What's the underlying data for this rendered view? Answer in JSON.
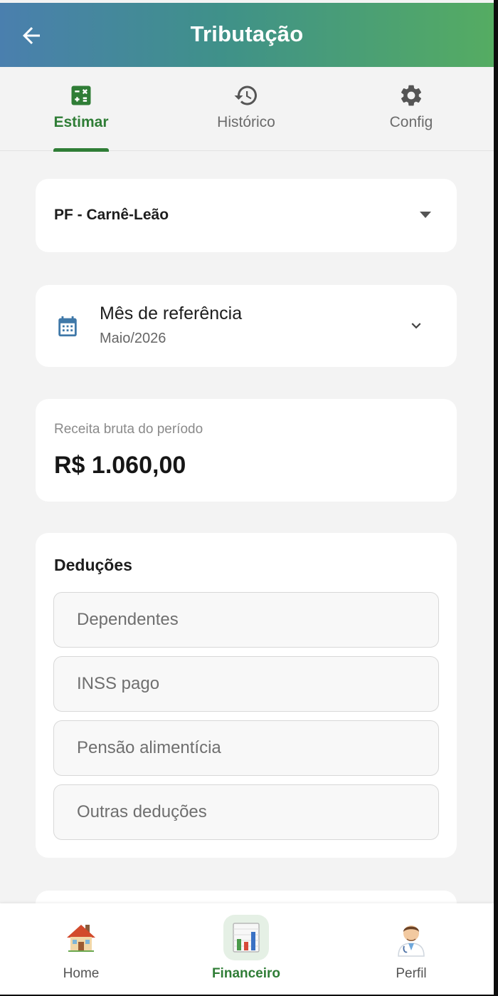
{
  "appbar": {
    "title": "Tributação"
  },
  "tabs": [
    {
      "label": "Estimar",
      "icon": "calculator-icon",
      "active": true
    },
    {
      "label": "Histórico",
      "icon": "history-icon",
      "active": false
    },
    {
      "label": "Config",
      "icon": "gear-icon",
      "active": false
    }
  ],
  "regime": {
    "selected": "PF - Carnê-Leão"
  },
  "month": {
    "label": "Mês de referência",
    "value": "Maio/2026"
  },
  "revenue": {
    "label": "Receita bruta do período",
    "value": "R$ 1.060,00"
  },
  "deductions": {
    "heading": "Deduções",
    "fields": [
      {
        "placeholder": "Dependentes"
      },
      {
        "placeholder": "INSS pago"
      },
      {
        "placeholder": "Pensão alimentícia"
      },
      {
        "placeholder": "Outras deduções"
      }
    ]
  },
  "bottomnav": [
    {
      "label": "Home",
      "icon": "house-icon",
      "active": false
    },
    {
      "label": "Financeiro",
      "icon": "bar-chart-icon",
      "active": true
    },
    {
      "label": "Perfil",
      "icon": "doctor-avatar-icon",
      "active": false
    }
  ],
  "colors": {
    "accent": "#2f7d36",
    "header_start": "#4a7fae",
    "header_end": "#55ac62"
  }
}
